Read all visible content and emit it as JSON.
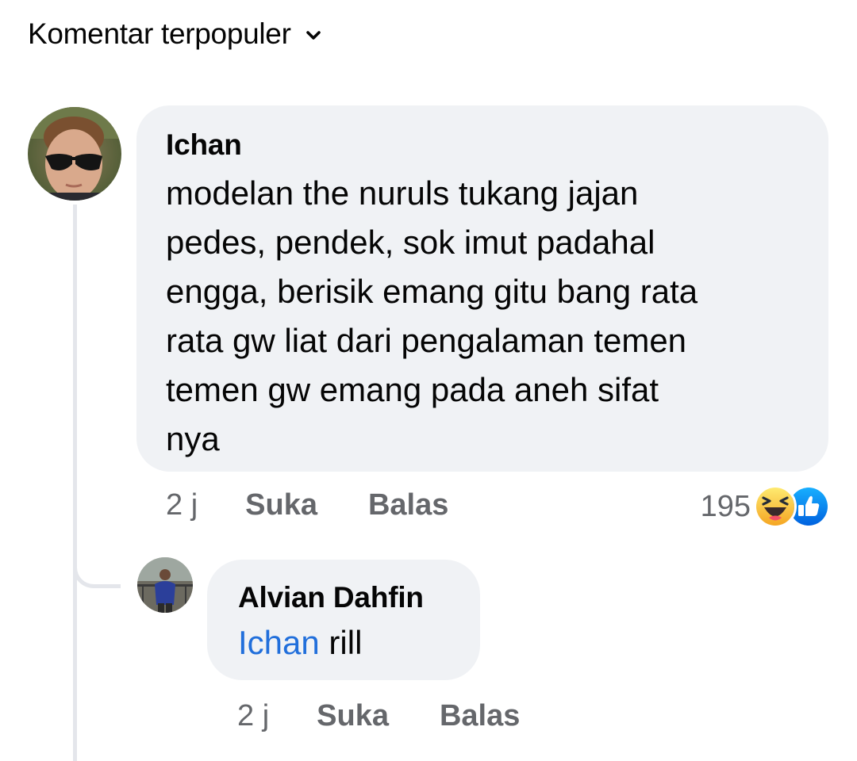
{
  "header": {
    "sort_label": "Komentar terpopuler"
  },
  "comment": {
    "author": "Ichan",
    "text": "modelan the nuruls tukang jajan\npedes, pendek, sok imut padahal\nengga, berisik emang gitu bang rata\nrata gw liat dari pengalaman temen\ntemen gw emang pada aneh sifat\nnya",
    "time": "2 j",
    "like_label": "Suka",
    "reply_label": "Balas",
    "reaction_count": "195",
    "reaction_icons": [
      "haha-reaction-icon",
      "like-reaction-icon"
    ]
  },
  "reply": {
    "author": "Alvian Dahfin",
    "mention": "Ichan",
    "text": " rill",
    "time": "2 j",
    "like_label": "Suka",
    "reply_label": "Balas"
  },
  "colors": {
    "bubble_bg": "#f0f2f5",
    "meta_text": "#65676b",
    "mention": "#216fdb",
    "like_blue": "#1877f2",
    "haha_yellow": "#f7b928"
  }
}
